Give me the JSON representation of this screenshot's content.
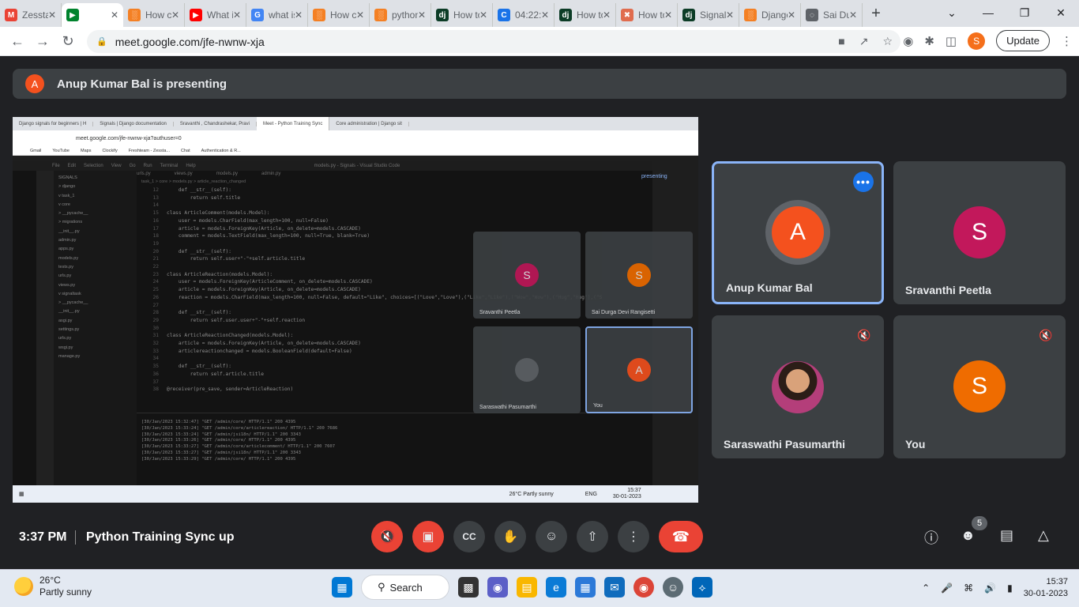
{
  "browser": {
    "tabs": [
      {
        "label": "Zessta",
        "fav": "M",
        "color": "#ea4335"
      },
      {
        "label": "",
        "fav": "▶",
        "color": "#00832d",
        "active": true
      },
      {
        "label": "How ca",
        "fav": "░",
        "color": "#f48024"
      },
      {
        "label": "What is",
        "fav": "▶",
        "color": "#ff0000"
      },
      {
        "label": "what is",
        "fav": "G",
        "color": "#4285f4"
      },
      {
        "label": "How ca",
        "fav": "░",
        "color": "#f48024"
      },
      {
        "label": "python",
        "fav": "░",
        "color": "#f48024"
      },
      {
        "label": "How to",
        "fav": "dj",
        "color": "#0c3c26"
      },
      {
        "label": "04:22:1",
        "fav": "C",
        "color": "#1a73e8"
      },
      {
        "label": "How to",
        "fav": "dj",
        "color": "#0c3c26"
      },
      {
        "label": "How to",
        "fav": "✖",
        "color": "#e06c4e"
      },
      {
        "label": "Signals",
        "fav": "dj",
        "color": "#0c3c26"
      },
      {
        "label": "Django",
        "fav": "░",
        "color": "#f48024"
      },
      {
        "label": "Sai Du",
        "fav": "◌",
        "color": "#5f6368"
      }
    ],
    "url": "meet.google.com/jfe-nwnw-xja",
    "update_label": "Update",
    "profile_initial": "S"
  },
  "presenting": {
    "initial": "A",
    "text": "Anup Kumar Bal is presenting"
  },
  "shared_screen": {
    "tabs": [
      "Django signals for beginners | H",
      "Signals | Django documentation",
      "Sravanthi , Chandrashekar, Pravi",
      "Meet - Python Training Sync",
      "Core administration | Django sit"
    ],
    "url": "meet.google.com/jfe-nwnw-xja?authuser=0",
    "bookmarks": [
      "Gmail",
      "YouTube",
      "Maps",
      "Clockify",
      "Freshteam - Zessta...",
      "Chat",
      "Authentication & R..."
    ],
    "editor_title": "models.py - Signals - Visual Studio Code",
    "menu": [
      "File",
      "Edit",
      "Selection",
      "View",
      "Go",
      "Run",
      "Terminal",
      "Help"
    ],
    "editor_tabs": [
      "urls.py",
      "views.py",
      "models.py",
      "admin.py"
    ],
    "breadcrumb": "task_1 > core > models.py > article_reaction_changed",
    "explorer": [
      "SIGNALS",
      "> django",
      "v task_1",
      "  v core",
      "    > __pycache__",
      "    > migrations",
      "    __init__.py",
      "    admin.py",
      "    apps.py",
      "    models.py",
      "    tests.py",
      "    urls.py",
      "    views.py",
      "  v signaltask",
      "    > __pycache__",
      "    __init__.py",
      "    asgi.py",
      "    settings.py",
      "    urls.py",
      "    wsgi.py",
      "  manage.py"
    ],
    "code": [
      [
        "12",
        "    def __str__(self):"
      ],
      [
        "13",
        "        return self.title"
      ],
      [
        "14",
        ""
      ],
      [
        "15",
        "class ArticleComment(models.Model):"
      ],
      [
        "16",
        "    user = models.CharField(max_length=100, null=False)"
      ],
      [
        "17",
        "    article = models.ForeignKey(Article, on_delete=models.CASCADE)"
      ],
      [
        "18",
        "    comment = models.TextField(max_length=100, null=True, blank=True)"
      ],
      [
        "19",
        ""
      ],
      [
        "20",
        "    def __str__(self):"
      ],
      [
        "21",
        "        return self.user+\"-\"+self.article.title"
      ],
      [
        "22",
        ""
      ],
      [
        "23",
        "class ArticleReaction(models.Model):"
      ],
      [
        "24",
        "    user = models.ForeignKey(ArticleComment, on_delete=models.CASCADE)"
      ],
      [
        "25",
        "    article = models.ForeignKey(Article, on_delete=models.CASCADE)"
      ],
      [
        "26",
        "    reaction = models.CharField(max_length=100, null=False, default=\"Like\", choices=[(\"Love\",\"Love\"),(\"Like\",\"Like\"),(\"Wow\",\"Wow\"),(\"Hug\",\"Hug\"),(\"S"
      ],
      [
        "27",
        ""
      ],
      [
        "28",
        "    def __str__(self):"
      ],
      [
        "29",
        "        return self.user.user+\"-\"+self.reaction"
      ],
      [
        "30",
        ""
      ],
      [
        "31",
        "class ArticleReactionChanged(models.Model):"
      ],
      [
        "32",
        "    article = models.ForeignKey(Article, on_delete=models.CASCADE)"
      ],
      [
        "33",
        "    articlereactionchanged = models.BooleanField(default=False)"
      ],
      [
        "34",
        ""
      ],
      [
        "35",
        "    def __str__(self):"
      ],
      [
        "36",
        "        return self.article.title"
      ],
      [
        "37",
        ""
      ],
      [
        "38",
        "@receiver(pre_save, sender=ArticleReaction)"
      ]
    ],
    "terminal": [
      "[30/Jan/2023 15:32:47] \"GET /admin/core/ HTTP/1.1\" 200 4395",
      "[30/Jan/2023 15:33:24] \"GET /admin/core/articlereaction/ HTTP/1.1\" 200 7686",
      "[30/Jan/2023 15:33:24] \"GET /admin/jsi18n/ HTTP/1.1\" 200 3343",
      "[30/Jan/2023 15:33:26] \"GET /admin/core/ HTTP/1.1\" 200 4395",
      "[30/Jan/2023 15:33:27] \"GET /admin/core/articlecomment/ HTTP/1.1\" 200 7607",
      "[30/Jan/2023 15:33:27] \"GET /admin/jsi18n/ HTTP/1.1\" 200 3343",
      "[30/Jan/2023 15:33:29] \"GET /admin/core/ HTTP/1.1\" 200 4395"
    ],
    "mini_tiles": [
      "Sravanthi Peetla",
      "Sai Durga Devi Rangisetti",
      "Saraswathi Pasumarthi",
      "You"
    ],
    "presenting_label": "presenting",
    "taskbar_weather": "26°C  Partly sunny",
    "taskbar_time": "15:37",
    "taskbar_date": "30-01-2023",
    "taskbar_lang": "ENG"
  },
  "participants": [
    {
      "name": "Anup Kumar Bal",
      "initial": "A",
      "color": "#f4511e",
      "speaking": true
    },
    {
      "name": "Sravanthi Peetla",
      "initial": "S",
      "color": "#c2185b",
      "muted": false
    },
    {
      "name": "Saraswathi Pasumarthi",
      "initial": "",
      "photo": true,
      "muted": true
    },
    {
      "name": "You",
      "initial": "S",
      "color": "#ef6c00",
      "muted": true
    }
  ],
  "controls": {
    "time": "3:37 PM",
    "meeting": "Python Training Sync up",
    "participants_count": "5"
  },
  "taskbar": {
    "temp": "26°C",
    "weather": "Partly sunny",
    "search_label": "Search",
    "time": "15:37",
    "date": "30-01-2023"
  }
}
